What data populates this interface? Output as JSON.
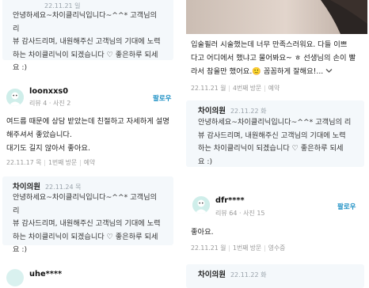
{
  "left": {
    "reply1": {
      "date": "22.11.21 일",
      "lines": [
        "안녕하세요~차이클리닉입니다~^^* 고객님의 리",
        "뷰 감사드리며, 내원해주신 고객님의 기대에 노력",
        "하는 차이클리닉이 되겠습니다 ♡ 좋은하루 되세",
        "요 :)"
      ]
    },
    "review2": {
      "nickname": "loonxxs0",
      "stats": "리뷰 4 · 사진 2",
      "follow": "팔로우",
      "lines": [
        "여드름 때문에 상담 받았는데 친절하고 자세하게 설명",
        "해주셔서 좋았습니다.",
        "대기도 길지 않아서 좋아요."
      ],
      "date": "22.11.17 목",
      "visit": "1번째 방문",
      "type": "예약"
    },
    "reply2": {
      "name": "차이의원",
      "date": "22.11.24 목",
      "lines": [
        "안녕하세요~차이클리닉입니다~^^* 고객님의 리",
        "뷰 감사드리며, 내원해주신 고객님의 기대에 노력",
        "하는 차이클리닉이 되겠습니다 ♡ 좋은하루 되세",
        "요 :)"
      ]
    },
    "review3": {
      "nickname": "uhe****"
    }
  },
  "right": {
    "review1": {
      "lines": [
        "입술필러 시술했는데 너무 만족스러워요. 다들 이쁘",
        "다고 어디에서 했냐고 물어봐요~ ㅎ 선생님의 손이 빨",
        "라서 참을만 했어요.🙂 꼼꼼하게 잘해요!..."
      ],
      "date": "22.11.21 월",
      "visit": "4번째 방문",
      "type": "예약"
    },
    "reply1": {
      "name": "차이의원",
      "date": "22.11.22 화",
      "lines": [
        "안녕하세요~차이클리닉입니다~^^* 고객님의 리",
        "뷰 감사드리며, 내원해주신 고객님의 기대에 노력",
        "하는 차이클리닉이 되겠습니다 ♡ 좋은하루 되세",
        "요 :)"
      ]
    },
    "review2": {
      "nickname": "dfr****",
      "stats": "리뷰 64 · 사진 15",
      "follow": "팔로우",
      "lines": [
        "좋아요."
      ],
      "date": "22.11.21 월",
      "visit": "1번째 방문",
      "type": "영수증"
    },
    "reply2": {
      "name": "차이의원",
      "date": "22.11.22 화"
    }
  },
  "colors": {
    "accent": "#1b8fc4",
    "reply_bg": "#f4f8fb",
    "meta": "#999999"
  },
  "icons": {
    "more": "chevron-down-icon",
    "avatar": "avatar-icon"
  }
}
